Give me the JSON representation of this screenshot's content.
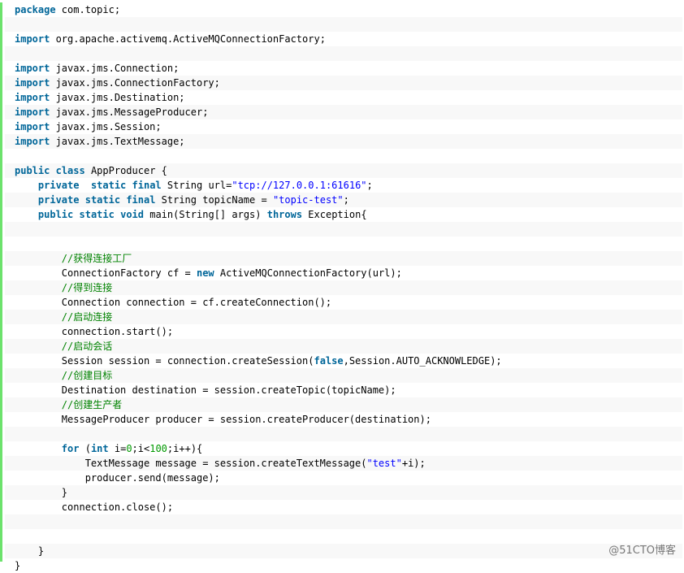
{
  "code_lines": [
    [
      [
        "kw",
        "package"
      ],
      [
        "t",
        " com.topic;"
      ]
    ],
    [],
    [
      [
        "kw",
        "import"
      ],
      [
        "t",
        " org.apache.activemq.ActiveMQConnectionFactory;"
      ]
    ],
    [],
    [
      [
        "kw",
        "import"
      ],
      [
        "t",
        " javax.jms.Connection;"
      ]
    ],
    [
      [
        "kw",
        "import"
      ],
      [
        "t",
        " javax.jms.ConnectionFactory;"
      ]
    ],
    [
      [
        "kw",
        "import"
      ],
      [
        "t",
        " javax.jms.Destination;"
      ]
    ],
    [
      [
        "kw",
        "import"
      ],
      [
        "t",
        " javax.jms.MessageProducer;"
      ]
    ],
    [
      [
        "kw",
        "import"
      ],
      [
        "t",
        " javax.jms.Session;"
      ]
    ],
    [
      [
        "kw",
        "import"
      ],
      [
        "t",
        " javax.jms.TextMessage;"
      ]
    ],
    [],
    [
      [
        "kw",
        "public"
      ],
      [
        "t",
        " "
      ],
      [
        "kw",
        "class"
      ],
      [
        "t",
        " AppProducer {"
      ]
    ],
    [
      [
        "t",
        "    "
      ],
      [
        "kw",
        "private"
      ],
      [
        "t",
        "  "
      ],
      [
        "kw",
        "static"
      ],
      [
        "t",
        " "
      ],
      [
        "kw",
        "final"
      ],
      [
        "t",
        " String url="
      ],
      [
        "str",
        "\"tcp://127.0.0.1:61616\""
      ],
      [
        "t",
        ";"
      ]
    ],
    [
      [
        "t",
        "    "
      ],
      [
        "kw",
        "private"
      ],
      [
        "t",
        " "
      ],
      [
        "kw",
        "static"
      ],
      [
        "t",
        " "
      ],
      [
        "kw",
        "final"
      ],
      [
        "t",
        " String topicName = "
      ],
      [
        "str",
        "\"topic-test\""
      ],
      [
        "t",
        ";"
      ]
    ],
    [
      [
        "t",
        "    "
      ],
      [
        "kw",
        "public"
      ],
      [
        "t",
        " "
      ],
      [
        "kw",
        "static"
      ],
      [
        "t",
        " "
      ],
      [
        "kw",
        "void"
      ],
      [
        "t",
        " main(String[] args) "
      ],
      [
        "kw",
        "throws"
      ],
      [
        "t",
        " Exception{"
      ]
    ],
    [],
    [],
    [
      [
        "t",
        "        "
      ],
      [
        "cmt",
        "//获得连接工厂"
      ]
    ],
    [
      [
        "t",
        "        ConnectionFactory cf = "
      ],
      [
        "kw",
        "new"
      ],
      [
        "t",
        " ActiveMQConnectionFactory(url);"
      ]
    ],
    [
      [
        "t",
        "        "
      ],
      [
        "cmt",
        "//得到连接"
      ]
    ],
    [
      [
        "t",
        "        Connection connection = cf.createConnection();"
      ]
    ],
    [
      [
        "t",
        "        "
      ],
      [
        "cmt",
        "//启动连接"
      ]
    ],
    [
      [
        "t",
        "        connection.start();"
      ]
    ],
    [
      [
        "t",
        "        "
      ],
      [
        "cmt",
        "//启动会话"
      ]
    ],
    [
      [
        "t",
        "        Session session = connection.createSession("
      ],
      [
        "kw",
        "false"
      ],
      [
        "t",
        ",Session.AUTO_ACKNOWLEDGE);"
      ]
    ],
    [
      [
        "t",
        "        "
      ],
      [
        "cmt",
        "//创建目标"
      ]
    ],
    [
      [
        "t",
        "        Destination destination = session.createTopic(topicName);"
      ]
    ],
    [
      [
        "t",
        "        "
      ],
      [
        "cmt",
        "//创建生产者"
      ]
    ],
    [
      [
        "t",
        "        MessageProducer producer = session.createProducer(destination);"
      ]
    ],
    [],
    [
      [
        "t",
        "        "
      ],
      [
        "kw",
        "for"
      ],
      [
        "t",
        " ("
      ],
      [
        "kw",
        "int"
      ],
      [
        "t",
        " i="
      ],
      [
        "num",
        "0"
      ],
      [
        "t",
        ";i<"
      ],
      [
        "num",
        "100"
      ],
      [
        "t",
        ";i++){"
      ]
    ],
    [
      [
        "t",
        "            TextMessage message = session.createTextMessage("
      ],
      [
        "str",
        "\"test\""
      ],
      [
        "t",
        "+i);"
      ]
    ],
    [
      [
        "t",
        "            producer.send(message);"
      ]
    ],
    [
      [
        "t",
        "        }"
      ]
    ],
    [
      [
        "t",
        "        connection.close();"
      ]
    ],
    [],
    [],
    [
      [
        "t",
        "    }"
      ]
    ],
    [
      [
        "t",
        "}"
      ]
    ]
  ],
  "watermark": "@51CTO博客",
  "colors": {
    "keyword": "#006699",
    "string": "#0000ff",
    "number": "#009900",
    "comment": "#008200",
    "gutter": "#6ce26c",
    "alt_row": "#f8f8f8"
  }
}
